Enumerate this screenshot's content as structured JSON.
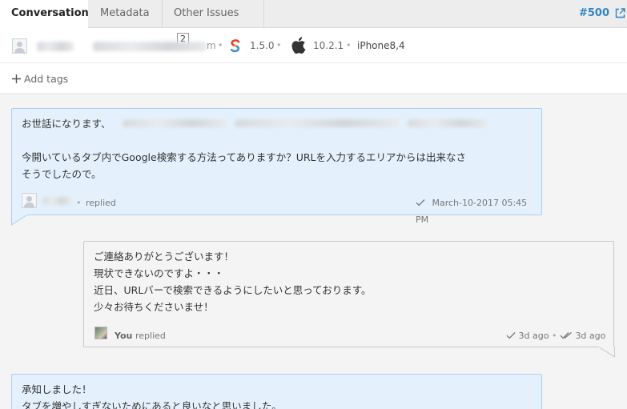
{
  "tabs": {
    "conversation": "Conversation",
    "metadata": "Metadata",
    "other_issues": "Other Issues",
    "other_issues_count": "2"
  },
  "issue_number": "#500",
  "info": {
    "email_visible_fragment": "m",
    "sdk_version": "1.5.0",
    "os_version": "10.2.1",
    "device": "iPhone8,4",
    "sdk_icon": "s-logo-icon",
    "os_icon": "apple-icon"
  },
  "add_tags_label": "Add tags",
  "messages": [
    {
      "role": "customer",
      "line1_prefix": "お世話になります、",
      "line2": "今開いているタブ内でGoogle検索する方法ってありますか？URLを入力するエリアからは出来なさ",
      "line3": "そうでしたので。",
      "action": "replied",
      "timestamp": "March-10-2017 05:45 PM"
    },
    {
      "role": "agent",
      "lines": [
        "ご連絡ありがとうございます！",
        "現状できないのですよ・・・",
        "近日、URLバーで検索できるようにしたいと思っております。",
        "少々お待ちくださいませ！"
      ],
      "author": "You",
      "action": "replied",
      "sent": "3d ago",
      "read": "3d ago"
    },
    {
      "role": "customer",
      "lines": [
        "承知しました！",
        "タブを増やしすぎないためにあると良いなと思いました。"
      ]
    }
  ],
  "colors": {
    "accent": "#2f84c8",
    "customer_bubble": "#e4f1fc",
    "agent_bubble": "#f4f4f4"
  }
}
